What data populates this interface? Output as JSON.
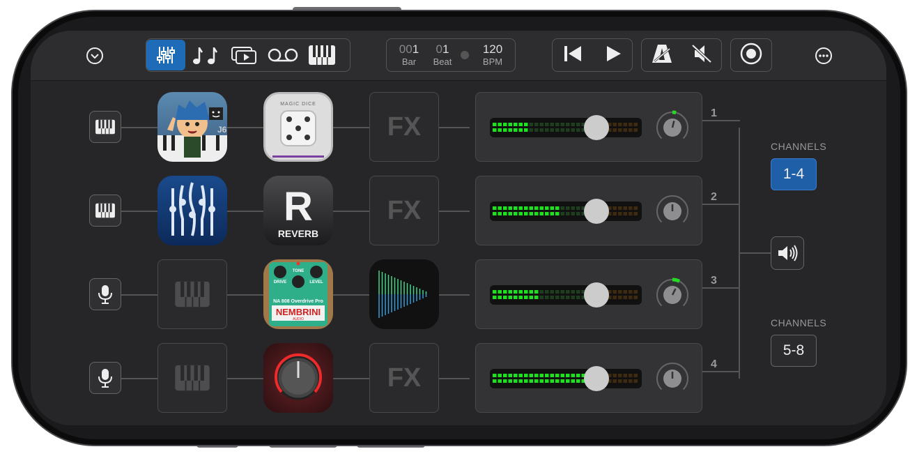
{
  "toolbar": {
    "icons": [
      "chevron-down-circle-icon",
      "mixer-icon",
      "notes-icon",
      "clip-player-icon",
      "tape-recorder-icon",
      "keyboard-icon",
      "skip-back-icon",
      "play-icon",
      "metronome-icon",
      "mute-icon",
      "record-icon",
      "more-icon"
    ],
    "active_tab": "mixer",
    "bar": {
      "dim": "00",
      "value": "1",
      "label": "Bar"
    },
    "beat": {
      "dim": "0",
      "value": "1",
      "label": "Beat"
    },
    "bpm": {
      "value": "120",
      "label": "BPM"
    }
  },
  "channels": [
    {
      "number": "1",
      "source": "keyboard-icon",
      "instrument": "jr-synth-app-icon",
      "effect": "magic-dice-app-icon",
      "fx": "FX",
      "meter_level": 0.25,
      "fader": 0.7,
      "pan": 0.55
    },
    {
      "number": "2",
      "source": "keyboard-icon",
      "instrument": "ripplemaker-app-icon",
      "effect": "reverb-app-icon",
      "effect_label": "REVERB",
      "fx": "FX",
      "meter_level": 0.48,
      "fader": 0.7,
      "pan": 0.5
    },
    {
      "number": "3",
      "source": "microphone-icon",
      "instrument": "keyboard-placeholder-icon",
      "effect": "overdrive-pedal-app-icon",
      "effect_labels": [
        "DRIVE",
        "TONE",
        "LEVEL",
        "NA 808 Overdrive Pro",
        "NEMBRINI",
        "AUDIO"
      ],
      "fx": "fx-waveform-app-icon",
      "meter_level": 0.33,
      "fader": 0.7,
      "pan": 0.6
    },
    {
      "number": "4",
      "source": "microphone-icon",
      "instrument": "keyboard-placeholder-icon",
      "effect": "red-knob-app-icon",
      "fx": "FX",
      "meter_level": 0.63,
      "fader": 0.7,
      "pan": 0.5
    }
  ],
  "app_labels": {
    "magic_dice": "MAGIC DICE",
    "jr_badge": "J6"
  },
  "sidebar": {
    "channels_label_1": "CHANNELS",
    "channels_btn_1": "1-4",
    "channels_label_2": "CHANNELS",
    "channels_btn_2": "5-8",
    "output_icon": "speaker-icon"
  },
  "colors": {
    "accent": "#1e6bb8",
    "meter_on": "#1ee01e",
    "meter_off": "#1f3d1f",
    "meter_hot": "#3d2a10",
    "pan_arc": "#22dd22"
  }
}
